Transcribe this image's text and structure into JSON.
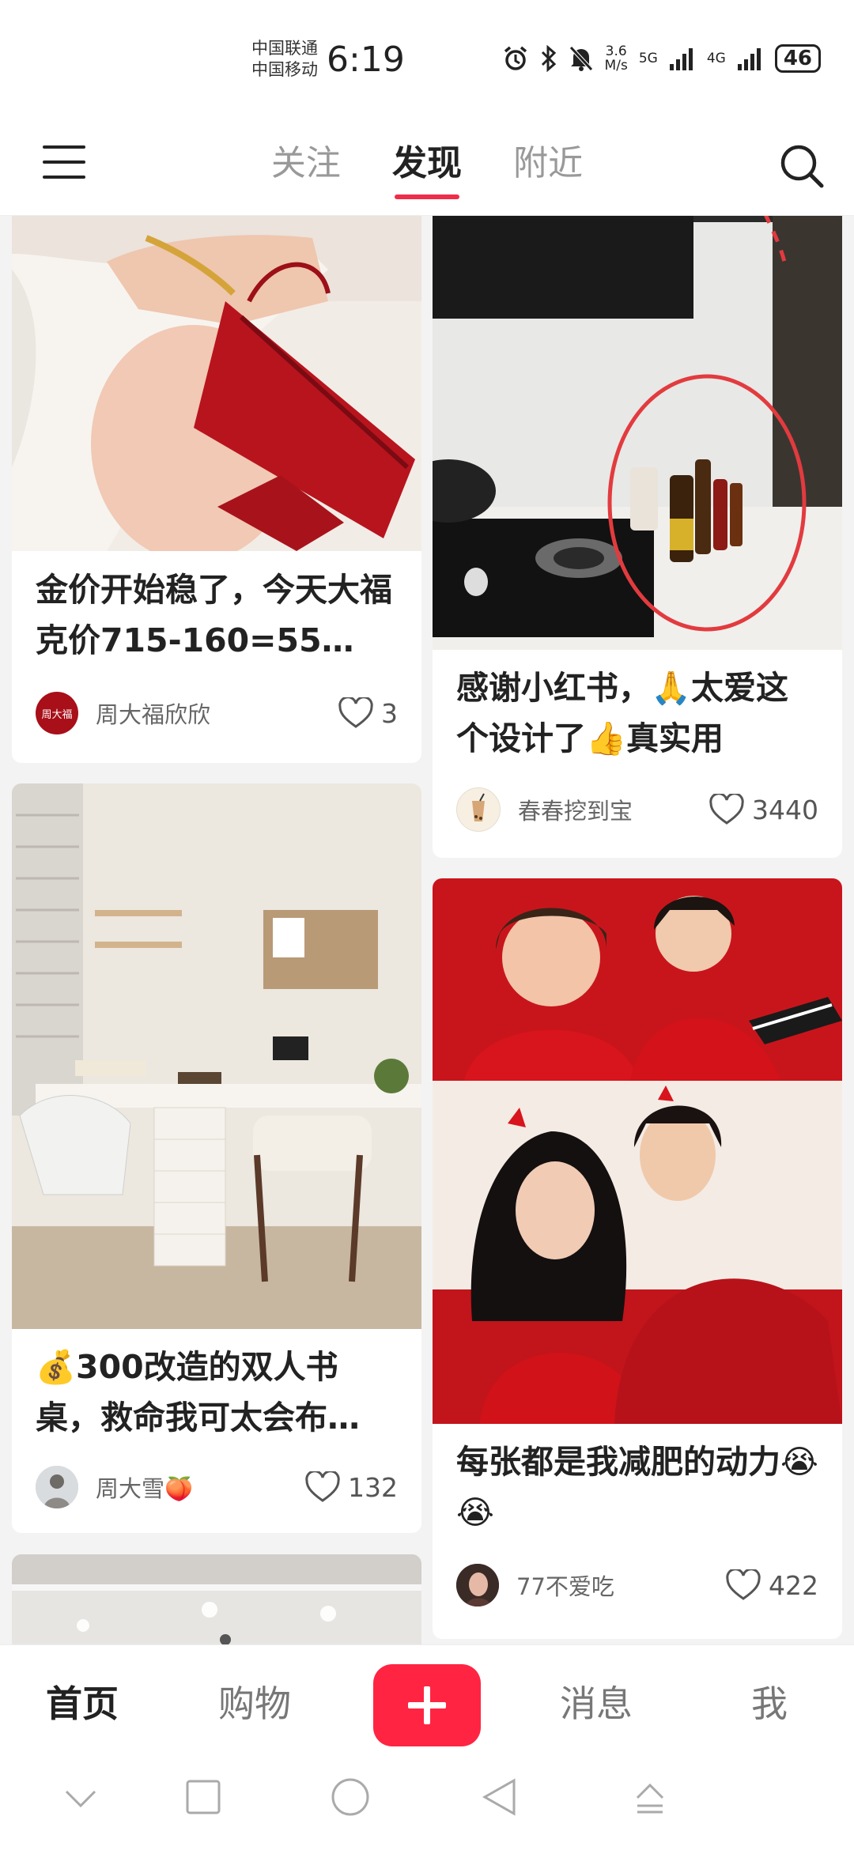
{
  "status_bar": {
    "carrier_1": "中国联通",
    "carrier_2": "中国移动",
    "time": "6:19",
    "speed_value": "3.6",
    "speed_unit": "M/s",
    "net_1": "5G",
    "net_2": "4G",
    "battery": "46",
    "icons": [
      "alarm-icon",
      "bluetooth-icon",
      "mute-icon",
      "signal-icon",
      "signal-icon",
      "battery-icon"
    ]
  },
  "top_nav": {
    "tabs": [
      {
        "label": "关注",
        "active": false
      },
      {
        "label": "发现",
        "active": true
      },
      {
        "label": "附近",
        "active": false
      }
    ],
    "accent_color": "#ee2d4a"
  },
  "feed": {
    "cards": [
      {
        "title": "金价开始稳了，今天大福克价715-160=55…",
        "author": "周大福欣欣",
        "likes": "3",
        "avatar_text": "周大福"
      },
      {
        "title": "感谢小红书，🙏太爱这个设计了👍真实用",
        "author": "春春挖到宝",
        "likes": "3440"
      },
      {
        "title": "💰300改造的双人书桌，救命我可太会布…",
        "author": "周大雪🍑",
        "likes": "132"
      },
      {
        "title": "每张都是我减肥的动力😭😭",
        "author": "77不爱吃",
        "likes": "422"
      }
    ]
  },
  "bottom_nav": {
    "items": [
      {
        "label": "首页",
        "active": true
      },
      {
        "label": "购物",
        "active": false
      },
      {
        "label": "消息",
        "active": false
      },
      {
        "label": "我",
        "active": false
      }
    ],
    "publish_icon": "plus-icon",
    "publish_color": "#ff2442"
  },
  "system_nav": {
    "icons": [
      "chevron-down-icon",
      "square-icon",
      "circle-icon",
      "back-triangle-icon",
      "upload-icon"
    ]
  }
}
